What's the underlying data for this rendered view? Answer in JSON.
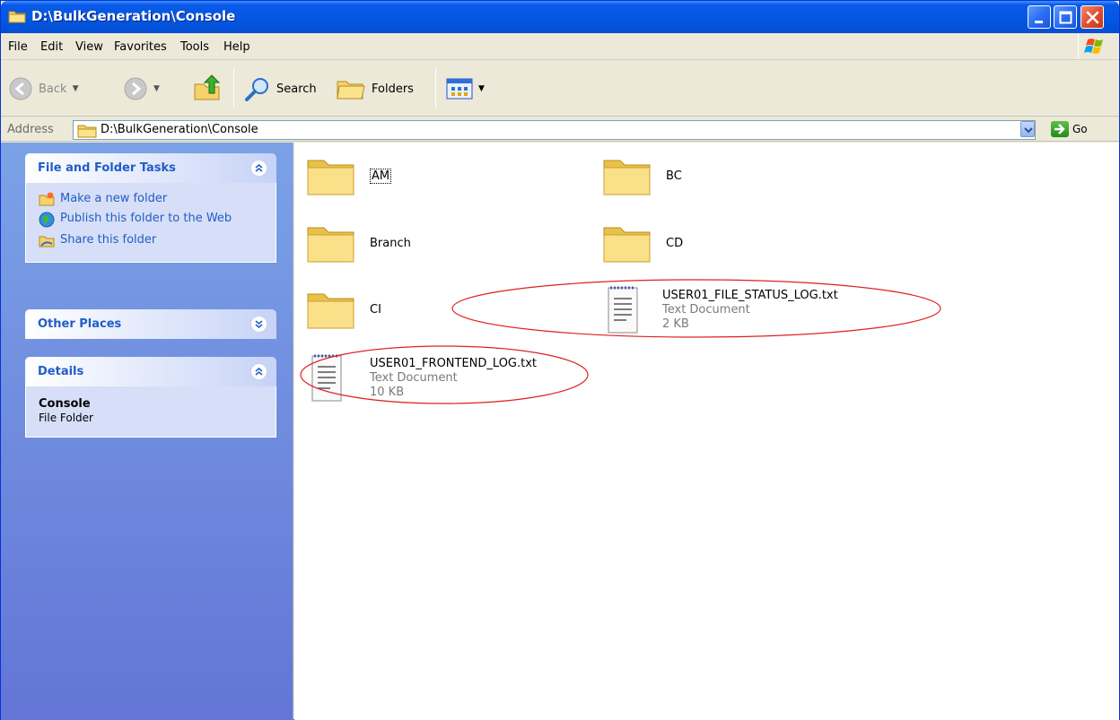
{
  "window": {
    "title": "D:\\BulkGeneration\\Console"
  },
  "menu": {
    "items": [
      "File",
      "Edit",
      "View",
      "Favorites",
      "Tools",
      "Help"
    ]
  },
  "toolbar": {
    "back_label": "Back",
    "search_label": "Search",
    "folders_label": "Folders"
  },
  "address": {
    "label": "Address",
    "value": "D:\\BulkGeneration\\Console",
    "go_label": "Go"
  },
  "sidebar": {
    "file_tasks": {
      "title": "File and Folder Tasks",
      "items": [
        {
          "label": "Make a new folder",
          "icon": "new-folder-icon"
        },
        {
          "label": "Publish this folder to the Web",
          "icon": "publish-web-icon"
        },
        {
          "label": "Share this folder",
          "icon": "share-folder-icon"
        }
      ]
    },
    "other_places": {
      "title": "Other Places"
    },
    "details": {
      "title": "Details",
      "name": "Console",
      "type": "File Folder"
    }
  },
  "files": [
    {
      "name": "AM",
      "kind": "folder"
    },
    {
      "name": "BC",
      "kind": "folder"
    },
    {
      "name": "Branch",
      "kind": "folder"
    },
    {
      "name": "CD",
      "kind": "folder"
    },
    {
      "name": "CI",
      "kind": "folder"
    },
    {
      "name": "USER01_FILE_STATUS_LOG.txt",
      "kind": "text",
      "type": "Text Document",
      "size": "2 KB"
    },
    {
      "name": "USER01_FRONTEND_LOG.txt",
      "kind": "text",
      "type": "Text Document",
      "size": "10 KB"
    }
  ],
  "colors": {
    "titlebar": "#0458e2",
    "sidebar_top": "#7ba2e7",
    "sidebar_bottom": "#6375d6",
    "task_link": "#215dc6",
    "annotation": "#e02020"
  }
}
